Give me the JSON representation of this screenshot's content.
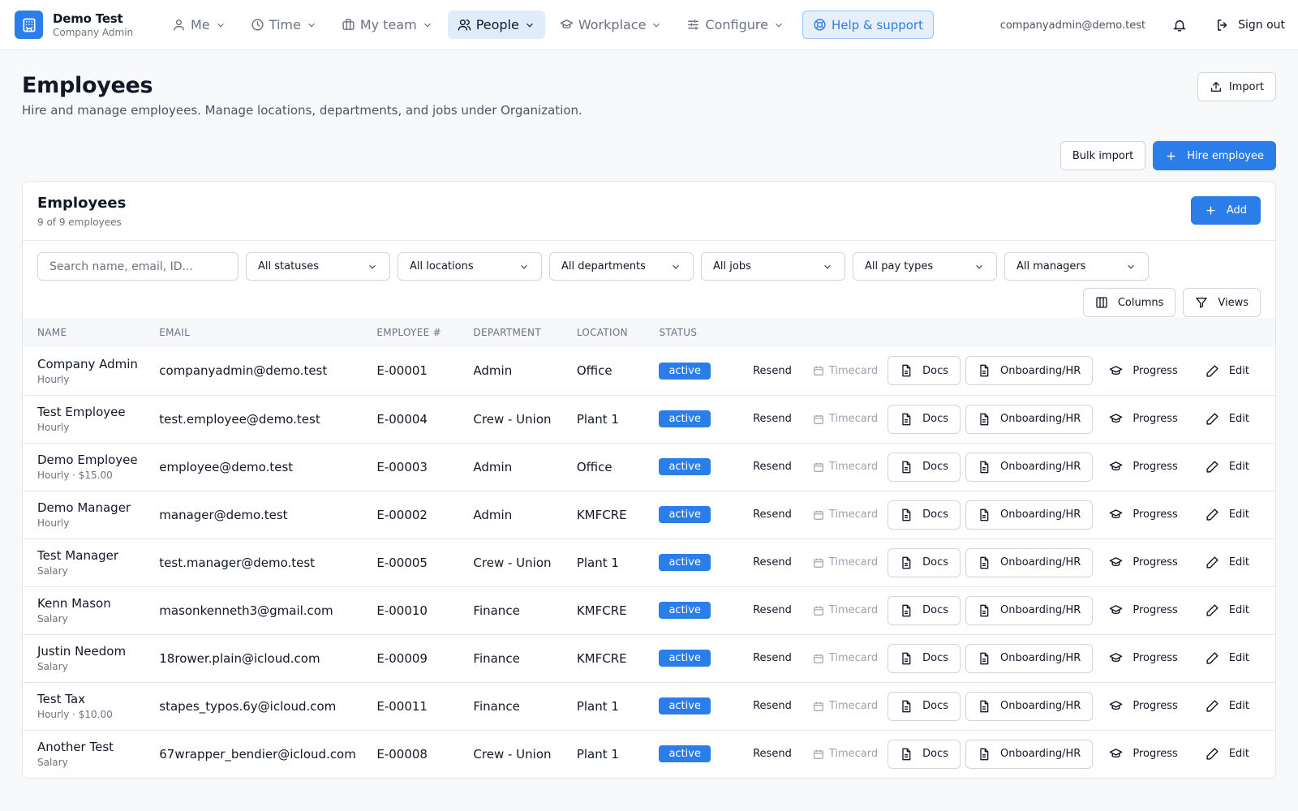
{
  "brand": {
    "name": "Demo Test",
    "role": "Company Admin"
  },
  "nav": [
    {
      "label": "Me",
      "icon": "user-icon"
    },
    {
      "label": "Time",
      "icon": "clock-icon"
    },
    {
      "label": "My team",
      "icon": "briefcase-icon"
    },
    {
      "label": "People",
      "icon": "users-icon",
      "active": true
    },
    {
      "label": "Workplace",
      "icon": "graduation-cap-icon"
    },
    {
      "label": "Configure",
      "icon": "sliders-icon"
    }
  ],
  "help_label": "Help & support",
  "user_email": "companyadmin@demo.test",
  "signout_label": "Sign out",
  "page": {
    "title": "Employees",
    "subtitle": "Hire and manage employees. Manage locations, departments, and jobs under Organization.",
    "import_label": "Import",
    "bulk_import_label": "Bulk import",
    "hire_label": "Hire employee"
  },
  "card": {
    "title": "Employees",
    "count": "9 of 9 employees",
    "add_label": "Add"
  },
  "filters": {
    "search_placeholder": "Search name, email, ID...",
    "selects": [
      "All statuses",
      "All locations",
      "All departments",
      "All jobs",
      "All pay types",
      "All managers"
    ],
    "columns_label": "Columns",
    "views_label": "Views"
  },
  "table": {
    "headers": [
      "NAME",
      "EMAIL",
      "EMPLOYEE #",
      "DEPARTMENT",
      "LOCATION",
      "STATUS"
    ],
    "actions": {
      "resend": "Resend",
      "timecard": "Timecard",
      "docs": "Docs",
      "onboarding": "Onboarding/HR",
      "progress": "Progress",
      "edit": "Edit"
    },
    "rows": [
      {
        "name": "Company Admin",
        "sub": "Hourly",
        "email": "companyadmin@demo.test",
        "num": "E-00001",
        "dept": "Admin",
        "loc": "Office",
        "status": "active"
      },
      {
        "name": "Test Employee",
        "sub": "Hourly",
        "email": "test.employee@demo.test",
        "num": "E-00004",
        "dept": "Crew - Union",
        "loc": "Plant 1",
        "status": "active"
      },
      {
        "name": "Demo Employee",
        "sub": "Hourly · $15.00",
        "email": "employee@demo.test",
        "num": "E-00003",
        "dept": "Admin",
        "loc": "Office",
        "status": "active"
      },
      {
        "name": "Demo Manager",
        "sub": "Hourly",
        "email": "manager@demo.test",
        "num": "E-00002",
        "dept": "Admin",
        "loc": "KMFCRE",
        "status": "active"
      },
      {
        "name": "Test Manager",
        "sub": "Salary",
        "email": "test.manager@demo.test",
        "num": "E-00005",
        "dept": "Crew - Union",
        "loc": "Plant 1",
        "status": "active"
      },
      {
        "name": "Kenn Mason",
        "sub": "Salary",
        "email": "masonkenneth3@gmail.com",
        "num": "E-00010",
        "dept": "Finance",
        "loc": "KMFCRE",
        "status": "active"
      },
      {
        "name": "Justin Needom",
        "sub": "Salary",
        "email": "18rower.plain@icloud.com",
        "num": "E-00009",
        "dept": "Finance",
        "loc": "KMFCRE",
        "status": "active"
      },
      {
        "name": "Test Tax",
        "sub": "Hourly · $10.00",
        "email": "stapes_typos.6y@icloud.com",
        "num": "E-00011",
        "dept": "Finance",
        "loc": "Plant 1",
        "status": "active"
      },
      {
        "name": "Another Test",
        "sub": "Salary",
        "email": "67wrapper_bendier@icloud.com",
        "num": "E-00008",
        "dept": "Crew - Union",
        "loc": "Plant 1",
        "status": "active"
      }
    ]
  },
  "colors": {
    "accent": "#2b7de9",
    "accent_soft": "#e1ecfb",
    "border": "#e5e7eb",
    "muted_text": "#6b7280"
  }
}
